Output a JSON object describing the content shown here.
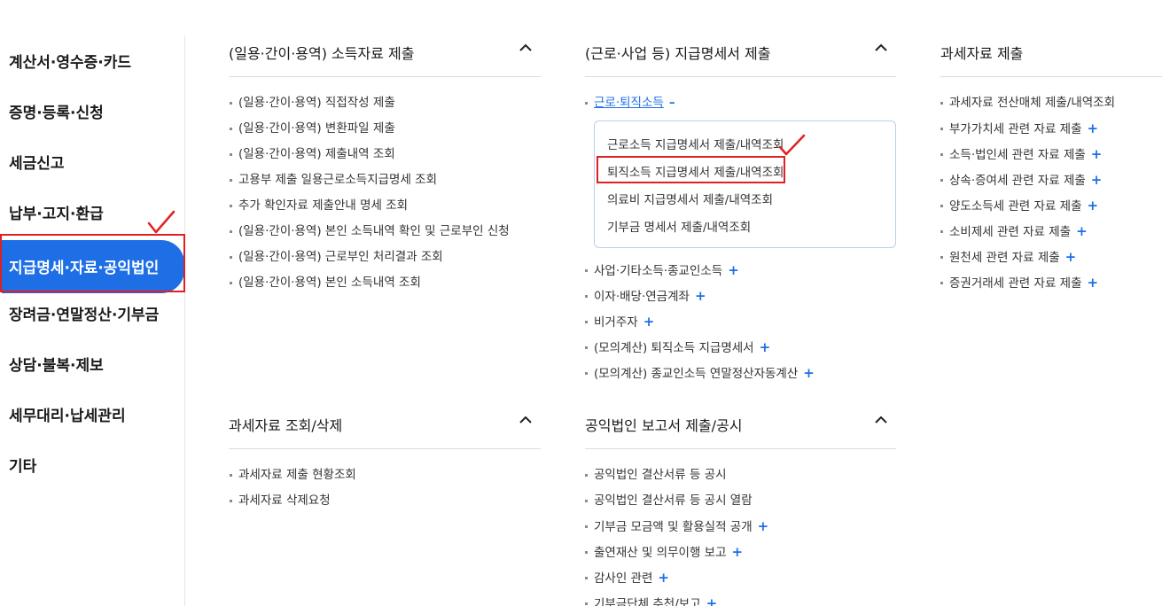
{
  "leftnav": {
    "items": [
      {
        "label": "계산서·영수증·카드"
      },
      {
        "label": "증명·등록·신청"
      },
      {
        "label": "세금신고"
      },
      {
        "label": "납부·고지·환급"
      },
      {
        "label": "지급명세·자료·공익법인"
      },
      {
        "label": "장려금·연말정산·기부금"
      },
      {
        "label": "상담·불복·제보"
      },
      {
        "label": "세무대리·납세관리"
      },
      {
        "label": "기타"
      }
    ],
    "active_index": 4
  },
  "sections": {
    "daily": {
      "title": "(일용·간이·용역) 소득자료 제출",
      "items": [
        "(일용·간이·용역) 직접작성 제출",
        "(일용·간이·용역) 변환파일 제출",
        "(일용·간이·용역) 제출내역 조회",
        "고용부 제출 일용근로소득지급명세 조회",
        "추가 확인자료 제출안내 명세 조회",
        "(일용·간이·용역) 본인 소득내역 확인 및 근로부인 신청",
        "(일용·간이·용역) 근로부인 처리결과 조회",
        "(일용·간이·용역) 본인 소득내역 조회"
      ]
    },
    "payment": {
      "title": "(근로·사업 등) 지급명세서 제출",
      "expanded_label": "근로·퇴직소득",
      "expanded_sign": "–",
      "sub_items": [
        "근로소득 지급명세서 제출/내역조회",
        "퇴직소득 지급명세서 제출/내역조회",
        "의료비 지급명세서 제출/내역조회",
        "기부금 명세서 제출/내역조회"
      ],
      "items": [
        "사업·기타소득·종교인소득",
        "이자·배당·연금계좌",
        "비거주자",
        "(모의계산) 퇴직소득 지급명세서",
        "(모의계산) 종교인소득 연말정산자동계산"
      ]
    },
    "taxdata": {
      "title": "과세자료 제출",
      "items": [
        {
          "label": "과세자료 전산매체 제출/내역조회",
          "plus": false
        },
        {
          "label": "부가가치세 관련 자료 제출",
          "plus": true
        },
        {
          "label": "소득·법인세 관련 자료 제출",
          "plus": true
        },
        {
          "label": "상속·증여세 관련 자료 제출",
          "plus": true
        },
        {
          "label": "양도소득세 관련 자료 제출",
          "plus": true
        },
        {
          "label": "소비제세 관련 자료 제출",
          "plus": true
        },
        {
          "label": "원천세 관련 자료 제출",
          "plus": true
        },
        {
          "label": "증권거래세 관련 자료 제출",
          "plus": true
        }
      ]
    },
    "lookup": {
      "title": "과세자료 조회/삭제",
      "items": [
        "과세자료 제출 현황조회",
        "과세자료 삭제요청"
      ]
    },
    "public": {
      "title": "공익법인 보고서 제출/공시",
      "items": [
        {
          "label": "공익법인 결산서류 등 공시",
          "plus": false
        },
        {
          "label": "공익법인 결산서류 등 공시 열람",
          "plus": false
        },
        {
          "label": "기부금 모금액 및 활용실적 공개",
          "plus": true
        },
        {
          "label": "출연재산 및 의무이행 보고",
          "plus": true
        },
        {
          "label": "감사인 관련",
          "plus": true
        },
        {
          "label": "기부금단체 추천/보고",
          "plus": true
        }
      ]
    }
  },
  "icons": {
    "collapse": "chevron-up-icon",
    "expand": "plus-icon",
    "annotation": "checkmark-annotation-icon"
  },
  "colors": {
    "accent": "#1e6fe6",
    "annotation": "#e02020"
  }
}
